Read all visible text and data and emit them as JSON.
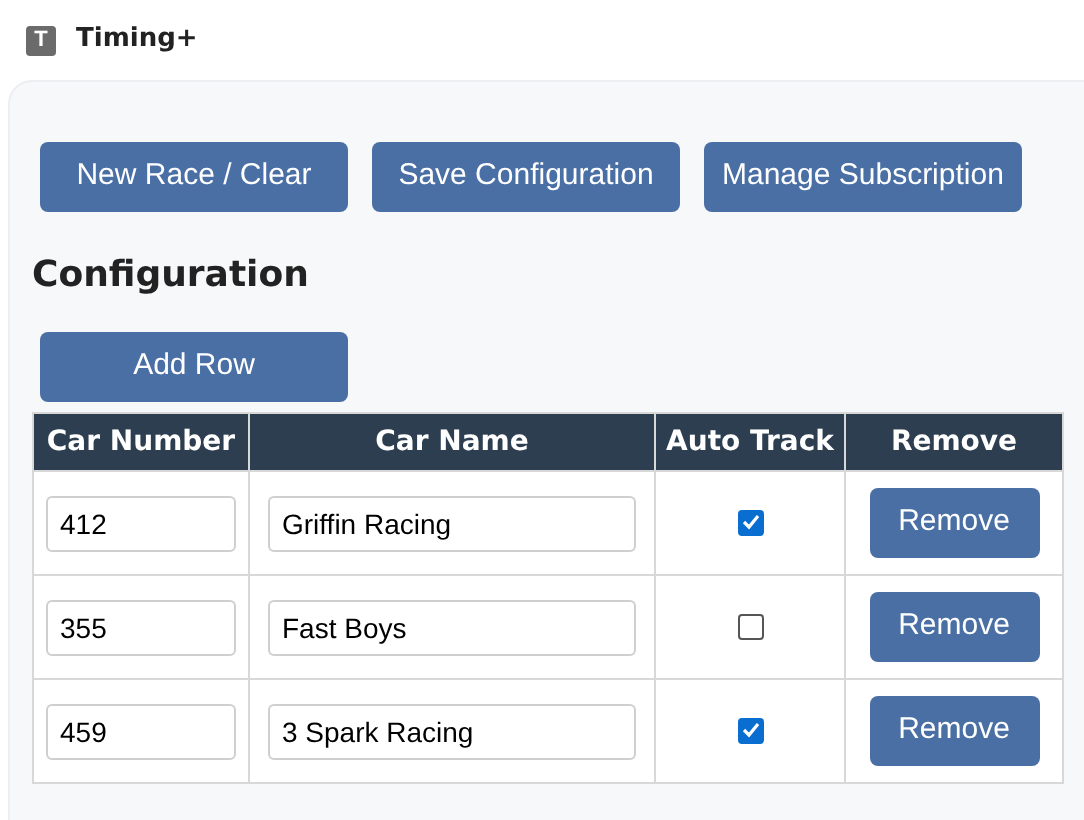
{
  "app": {
    "icon_letter": "T",
    "title": "Timing+"
  },
  "toolbar": [
    "New Race / Clear",
    "Save Configuration",
    "Manage Subscription"
  ],
  "section_title": "Configuration",
  "add_button": "Add Row",
  "table": {
    "columns": [
      "Car Number",
      "Car Name",
      "Auto Track",
      "Remove"
    ],
    "rows": [
      {
        "car_number": "412",
        "car_name": "Griffin Racing",
        "auto_track": true,
        "action": "Remove"
      },
      {
        "car_number": "355",
        "car_name": "Fast Boys",
        "auto_track": false,
        "action": "Remove"
      },
      {
        "car_number": "459",
        "car_name": "3 Spark Racing",
        "auto_track": true,
        "action": "Remove"
      }
    ]
  }
}
